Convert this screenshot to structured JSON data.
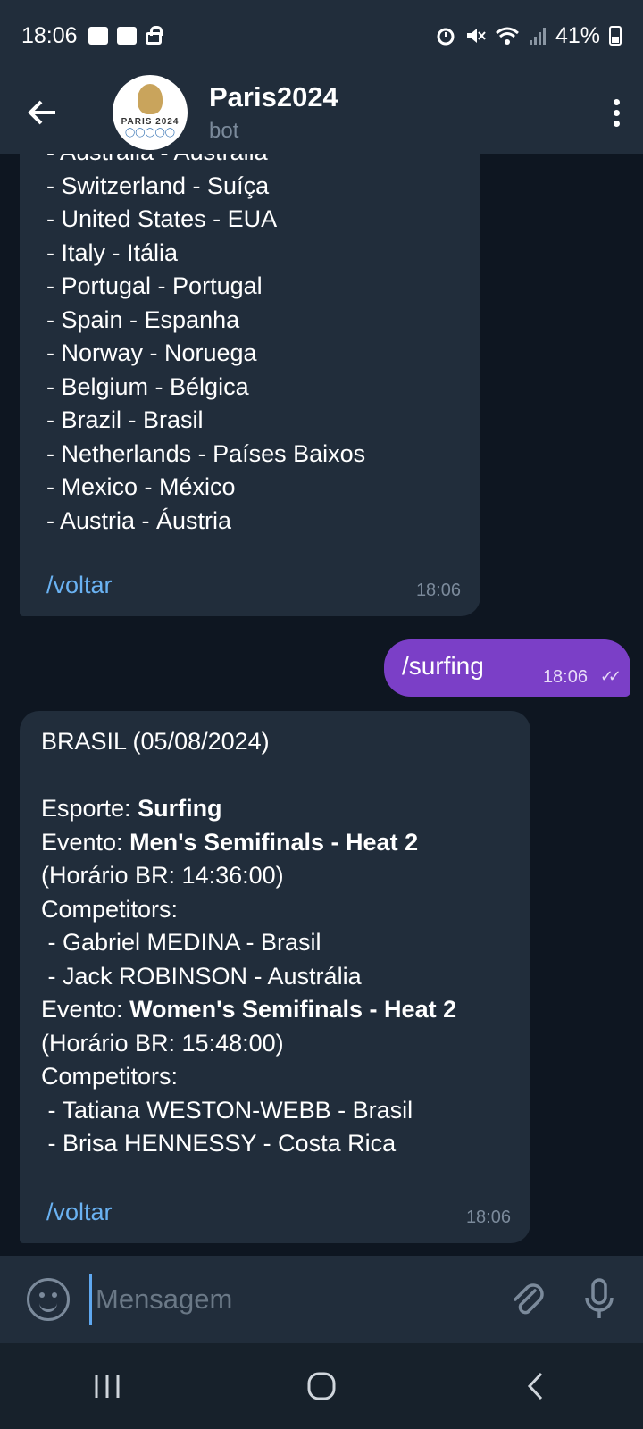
{
  "status_bar": {
    "time": "18:06",
    "battery": "41%",
    "battery_level": 0.41
  },
  "header": {
    "title": "Paris2024",
    "subtitle": "bot",
    "avatar_text": "PARIS 2024"
  },
  "messages": [
    {
      "from": "bot",
      "lines": [
        "- Australia - Austrália",
        "- Switzerland - Suíça",
        "- United States - EUA",
        "- Italy - Itália",
        "- Portugal - Portugal",
        "- Spain - Espanha",
        "- Norway - Noruega",
        "- Belgium - Bélgica",
        "- Brazil - Brasil",
        "- Netherlands - Países Baixos",
        "- Mexico - México",
        "- Austria - Áustria"
      ],
      "link": "/voltar",
      "time": "18:06"
    },
    {
      "from": "user",
      "text": "/surfing",
      "time": "18:06"
    },
    {
      "from": "bot",
      "title": "BRASIL (05/08/2024)",
      "sport_label": "Esporte: ",
      "sport": "Surfing",
      "event1_label": "Evento: ",
      "event1": "Men's Semifinals - Heat 2",
      "event1_time": "(Horário BR: 14:36:00)",
      "competitors_label": "Competitors:",
      "event1_competitors": [
        " - Gabriel MEDINA - Brasil",
        " - Jack ROBINSON - Austrália"
      ],
      "event2_label": "Evento: ",
      "event2": "Women's Semifinals - Heat 2",
      "event2_time": "(Horário BR: 15:48:00)",
      "event2_competitors": [
        " - Tatiana WESTON-WEBB - Brasil",
        " - Brisa HENNESSY - Costa Rica"
      ],
      "link": "/voltar",
      "time": "18:06"
    }
  ],
  "input": {
    "placeholder": "Mensagem"
  },
  "colors": {
    "chat_bg": "#0e1621",
    "bubble_in": "#212d3b",
    "bubble_out": "#7b3fc7",
    "link": "#6ab2f2",
    "header": "#212d3b"
  },
  "icons": {
    "back": "arrow-left-icon",
    "menu": "more-vertical-icon",
    "emoji": "smile-icon",
    "attach": "paperclip-icon",
    "mic": "microphone-icon",
    "nav_recent": "recent-apps-icon",
    "nav_home": "home-icon",
    "nav_back": "back-chevron-icon"
  }
}
